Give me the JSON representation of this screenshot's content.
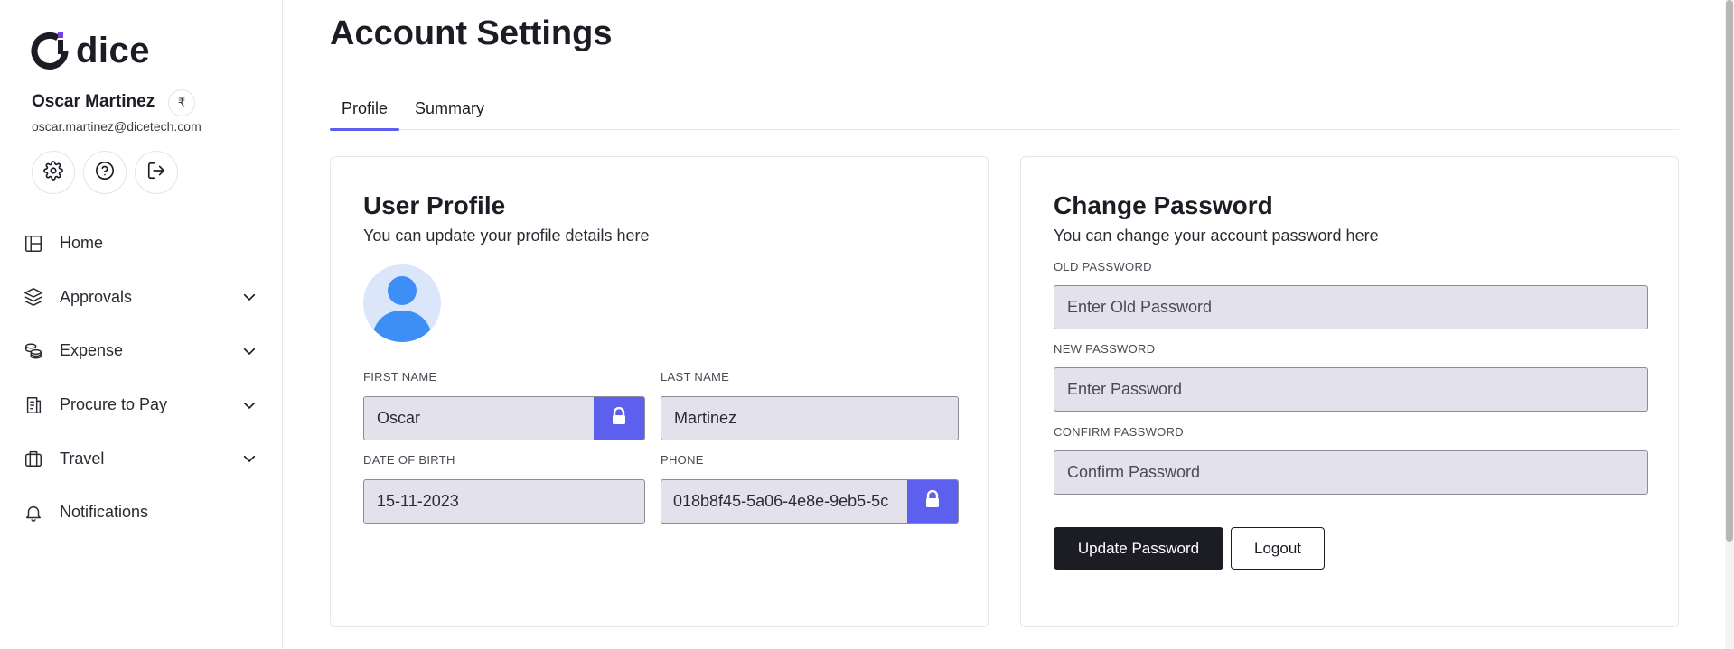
{
  "brand": {
    "name": "dice",
    "accent": "#5d5fef",
    "dot_color": "#7b3fe4"
  },
  "user": {
    "name": "Oscar Martinez",
    "email": "oscar.martinez@dicetech.com",
    "currency_symbol": "₹"
  },
  "sidebar": {
    "icon_buttons": [
      {
        "icon": "gear-icon"
      },
      {
        "icon": "help-circle-icon"
      },
      {
        "icon": "logout-icon"
      }
    ],
    "items": [
      {
        "label": "Home",
        "icon": "home-layout-icon",
        "expandable": false
      },
      {
        "label": "Approvals",
        "icon": "layers-icon",
        "expandable": true
      },
      {
        "label": "Expense",
        "icon": "coins-icon",
        "expandable": true
      },
      {
        "label": "Procure to Pay",
        "icon": "receipt-icon",
        "expandable": true
      },
      {
        "label": "Travel",
        "icon": "briefcase-icon",
        "expandable": true
      },
      {
        "label": "Notifications",
        "icon": "bell-icon",
        "expandable": false
      }
    ]
  },
  "page": {
    "title": "Account Settings"
  },
  "tabs": [
    {
      "label": "Profile",
      "active": true
    },
    {
      "label": "Summary",
      "active": false
    }
  ],
  "profile": {
    "title": "User Profile",
    "subtitle": "You can update your profile details here",
    "first_name": {
      "label": "FIRST NAME",
      "value": "Oscar",
      "locked": true
    },
    "last_name": {
      "label": "LAST NAME",
      "value": "Martinez"
    },
    "dob": {
      "label": "DATE OF BIRTH",
      "value": "15-11-2023"
    },
    "phone": {
      "label": "PHONE",
      "value": "018b8f45-5a06-4e8e-9eb5-5c",
      "locked": true
    }
  },
  "password": {
    "title": "Change Password",
    "subtitle": "You can change your account password here",
    "old": {
      "label": "OLD PASSWORD",
      "placeholder": "Enter Old Password"
    },
    "new": {
      "label": "NEW PASSWORD",
      "placeholder": "Enter Password"
    },
    "confirm": {
      "label": "CONFIRM PASSWORD",
      "placeholder": "Confirm Password"
    },
    "update_label": "Update Password",
    "logout_label": "Logout"
  }
}
